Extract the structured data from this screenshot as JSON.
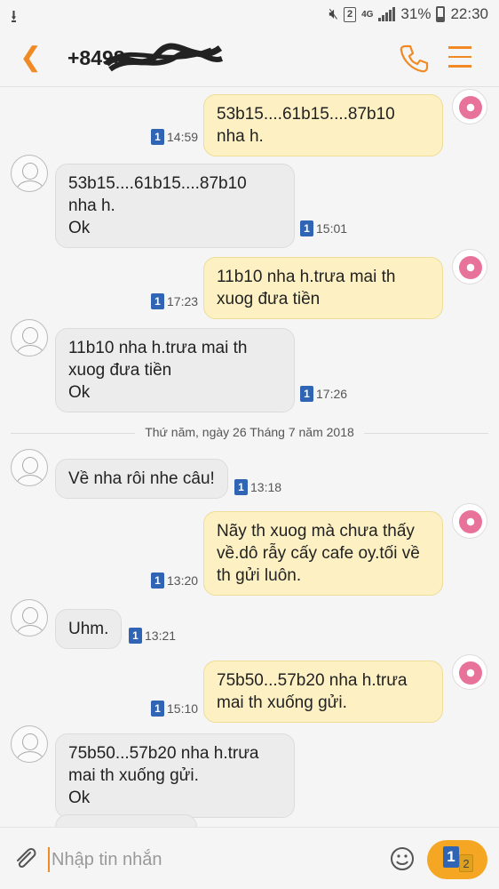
{
  "status_bar": {
    "battery": "31%",
    "time": "22:30",
    "network": "4G",
    "sim_slot": "2"
  },
  "header": {
    "contact": "+8498"
  },
  "messages": [
    {
      "dir": "out",
      "text": "53b15....61b15....87b10\nnha h.",
      "time": "14:59",
      "sim": "1"
    },
    {
      "dir": "in",
      "text": "53b15....61b15....87b10\nnha h.\nOk",
      "time": "15:01",
      "sim": "1"
    },
    {
      "dir": "out",
      "text": "11b10 nha h.trưa mai th\nxuog đưa tiền",
      "time": "17:23",
      "sim": "1"
    },
    {
      "dir": "in",
      "text": "11b10 nha h.trưa mai th\nxuog đưa tiền\nOk",
      "time": "17:26",
      "sim": "1"
    },
    {
      "dir": "in",
      "text": "Về nha rôi nhe câu!",
      "time": "13:18",
      "sim": "1"
    },
    {
      "dir": "out",
      "text": "Nãy th xuog mà chưa thấy\nvề.dô rẫy cấy cafe oy.tối về\nth gửi luôn.",
      "time": "13:20",
      "sim": "1"
    },
    {
      "dir": "in",
      "text": "Uhm.",
      "time": "13:21",
      "sim": "1"
    },
    {
      "dir": "out",
      "text": "75b50...57b20 nha h.trưa\nmai th xuống gửi.",
      "time": "15:10",
      "sim": "1"
    },
    {
      "dir": "in",
      "text": "75b50...57b20 nha h.trưa\nmai th xuống gửi.\nOk",
      "time": "",
      "sim": ""
    }
  ],
  "date_separator": "Thứ năm, ngày 26 Tháng 7 năm 2018",
  "composer": {
    "placeholder": "Nhập tin nhắn",
    "send_sim_primary": "1",
    "send_sim_secondary": "2"
  },
  "colors": {
    "accent": "#f08a24",
    "outgoing_bubble": "#fdf1c4",
    "incoming_bubble": "#ececec",
    "sim_badge": "#2f65b4"
  }
}
